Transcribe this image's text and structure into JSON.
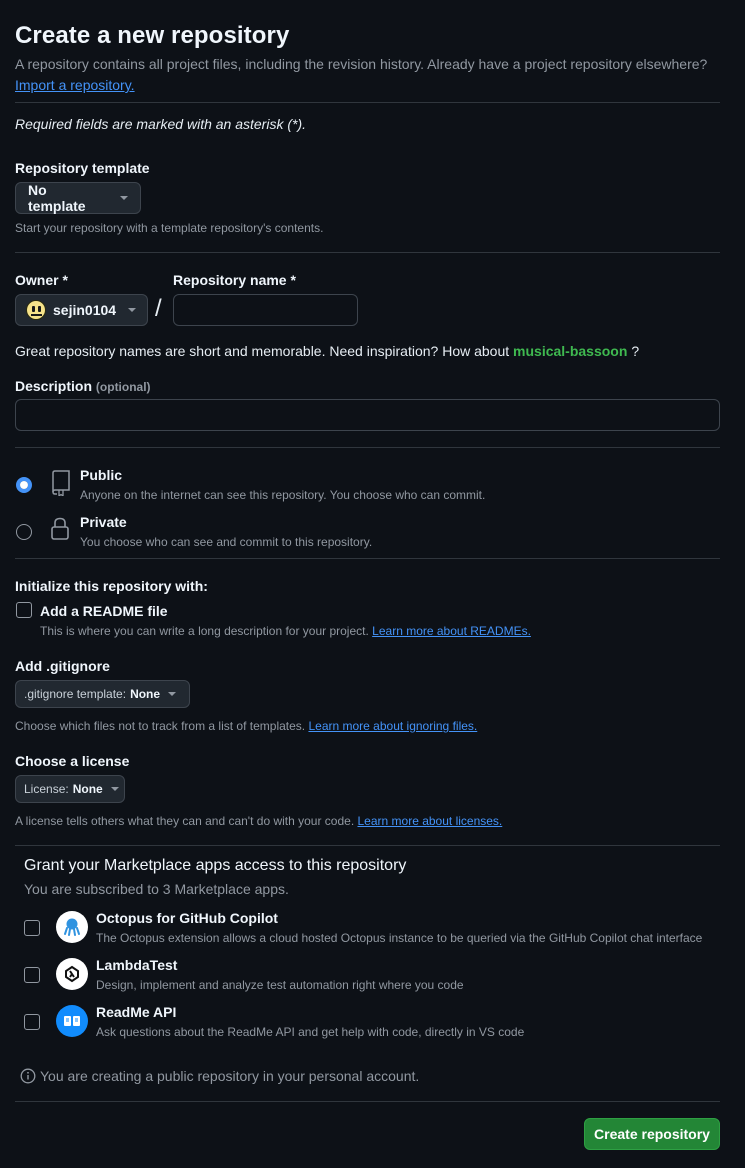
{
  "header": {
    "title": "Create a new repository",
    "subtitle": "A repository contains all project files, including the revision history. Already have a project repository elsewhere?",
    "import_link": "Import a repository."
  },
  "required_note": "Required fields are marked with an asterisk (*).",
  "template": {
    "label": "Repository template",
    "value": "No template",
    "hint": "Start your repository with a template repository's contents."
  },
  "owner": {
    "label": "Owner *",
    "value": "sejin0104",
    "separator": "/"
  },
  "repo_name": {
    "label": "Repository name *",
    "value": ""
  },
  "name_hint": {
    "text": "Great repository names are short and memorable. Need inspiration? How about",
    "suggestion": "musical-bassoon",
    "suffix": "?"
  },
  "description": {
    "label": "Description",
    "optional": "(optional)",
    "value": ""
  },
  "visibility": {
    "public": {
      "label": "Public",
      "hint": "Anyone on the internet can see this repository. You choose who can commit.",
      "checked": true
    },
    "private": {
      "label": "Private",
      "hint": "You choose who can see and commit to this repository.",
      "checked": false
    }
  },
  "initialize": {
    "label": "Initialize this repository with:",
    "readme": {
      "label": "Add a README file",
      "hint": "This is where you can write a long description for your project.",
      "link": "Learn more about READMEs."
    }
  },
  "gitignore": {
    "label": "Add .gitignore",
    "prefix": ".gitignore template:",
    "value": "None",
    "hint": "Choose which files not to track from a list of templates.",
    "link": "Learn more about ignoring files."
  },
  "license": {
    "label": "Choose a license",
    "prefix": "License:",
    "value": "None",
    "hint": "A license tells others what they can and can't do with your code.",
    "link": "Learn more about licenses."
  },
  "marketplace": {
    "title": "Grant your Marketplace apps access to this repository",
    "subtitle": "You are subscribed to 3 Marketplace apps.",
    "apps": [
      {
        "name": "Octopus for GitHub Copilot",
        "description": "The Octopus extension allows a cloud hosted Octopus instance to be queried via the GitHub Copilot chat interface",
        "icon": "octopus-icon",
        "color": "#2f93e0"
      },
      {
        "name": "LambdaTest",
        "description": "Design, implement and analyze test automation right where you code",
        "icon": "lambdatest-icon",
        "color": "#ffffff"
      },
      {
        "name": "ReadMe API",
        "description": "Ask questions about the ReadMe API and get help with code, directly in VS code",
        "icon": "readme-book-icon",
        "color": "#118cfd"
      }
    ]
  },
  "footer_note": "You are creating a public repository in your personal account.",
  "submit": "Create repository",
  "colors": {
    "background": "#0d1117",
    "link": "#4493f8",
    "primary_button": "#238636",
    "suggestion": "#3fb950"
  }
}
